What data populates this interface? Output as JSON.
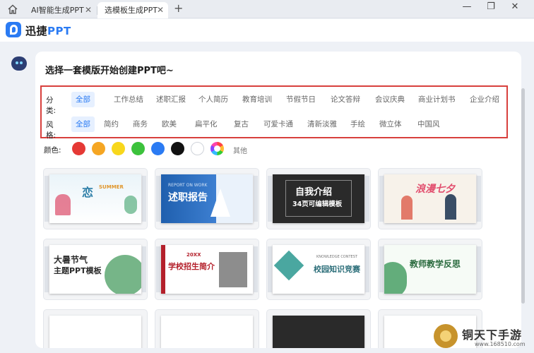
{
  "tabs": [
    {
      "label": "AI智能生成PPT"
    },
    {
      "label": "选模板生成PPT"
    }
  ],
  "app": {
    "title_main": "迅捷",
    "title_accent": "PPT"
  },
  "main": {
    "headline": "选择一套模版开始创建PPT吧~"
  },
  "filters": {
    "category_label": "分类:",
    "categories": [
      "全部",
      "工作总结",
      "述职汇报",
      "个人简历",
      "教育培训",
      "节假节日",
      "论文答辩",
      "会议庆典",
      "商业计划书",
      "企业介绍"
    ],
    "style_label": "风格:",
    "styles": [
      "全部",
      "简约",
      "商务",
      "欧美",
      "扁平化",
      "复古",
      "可爱卡通",
      "清新淡雅",
      "手绘",
      "微立体",
      "中国风"
    ],
    "selected_category": "全部",
    "selected_style": "全部"
  },
  "colors": {
    "label": "颜色:",
    "swatches": [
      "#e53935",
      "#f5a623",
      "#f8d71c",
      "#3cc23c",
      "#2b7bf3",
      "#111111",
      "#ffffff",
      "multicolor"
    ],
    "other_label": "其他"
  },
  "templates": [
    {
      "title": "恋",
      "sub": "SUMMER"
    },
    {
      "title": "述职报告",
      "sub": "REPORT ON WORK"
    },
    {
      "title": "自我介绍",
      "sub": "34页可编辑模板"
    },
    {
      "title": "浪漫七夕",
      "sub": ""
    },
    {
      "title": "大暑节气",
      "sub": "主题PPT模板"
    },
    {
      "title": "学校招生简介",
      "sub": "20XX"
    },
    {
      "title": "校园知识竞赛",
      "sub": "KNOWLEDGE CONTEST"
    },
    {
      "title": "教师教学反思",
      "sub": ""
    }
  ],
  "watermark": {
    "text": "铜天下手游",
    "url": "www.168510.com"
  }
}
